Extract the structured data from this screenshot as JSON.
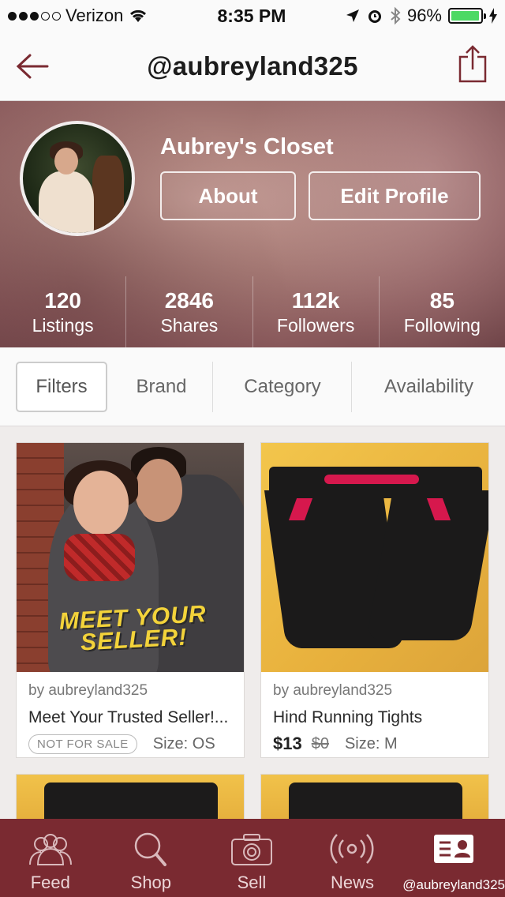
{
  "status_bar": {
    "carrier": "Verizon",
    "signal_bars_filled": 3,
    "signal_bars_total": 5,
    "time": "8:35 PM",
    "battery_percent": "96%",
    "icons": [
      "wifi-icon",
      "location-arrow-icon",
      "alarm-icon",
      "bluetooth-icon",
      "battery-icon",
      "charging-bolt-icon"
    ]
  },
  "navbar": {
    "title": "@aubreyland325",
    "back_icon": "back-arrow-icon",
    "share_icon": "share-icon"
  },
  "profile": {
    "name": "Aubrey's Closet",
    "about_label": "About",
    "edit_label": "Edit Profile",
    "stats": [
      {
        "value": "120",
        "label": "Listings"
      },
      {
        "value": "2846",
        "label": "Shares"
      },
      {
        "value": "112k",
        "label": "Followers"
      },
      {
        "value": "85",
        "label": "Following"
      }
    ]
  },
  "filters": {
    "filters_label": "Filters",
    "brand_label": "Brand",
    "category_label": "Category",
    "availability_label": "Availability"
  },
  "listings": [
    {
      "seller": "by aubreyland325",
      "title": "Meet Your Trusted Seller!...",
      "badge": "NOT FOR SALE",
      "size": "Size: OS",
      "image_text_line1": "MEET YOUR",
      "image_text_line2": "SELLER!"
    },
    {
      "seller": "by aubreyland325",
      "title": "Hind Running Tights",
      "price": "$13",
      "original_price": "$0",
      "size": "Size: M"
    }
  ],
  "tabbar": {
    "items": [
      {
        "label": "Feed",
        "icon": "people-icon"
      },
      {
        "label": "Shop",
        "icon": "search-icon"
      },
      {
        "label": "Sell",
        "icon": "camera-icon"
      },
      {
        "label": "News",
        "icon": "broadcast-icon"
      },
      {
        "label": "@aubreyland325",
        "icon": "profile-card-icon"
      }
    ]
  },
  "colors": {
    "brand": "#7a2a31",
    "accent_text": "#7a2a31",
    "battery": "#4cd964"
  }
}
